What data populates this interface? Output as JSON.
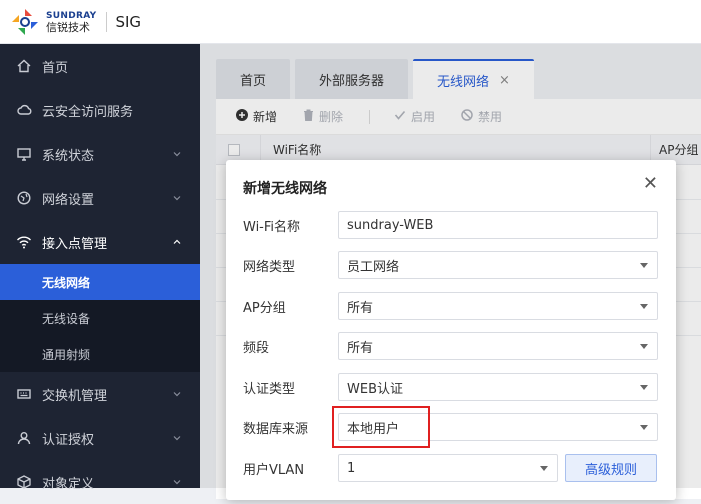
{
  "brand": {
    "en": "SUNDRAY",
    "cn": "信锐技术",
    "product": "SIG"
  },
  "sidebar": {
    "items": [
      {
        "label": "首页",
        "icon": "home-icon"
      },
      {
        "label": "云安全访问服务",
        "icon": "cloud-icon"
      },
      {
        "label": "系统状态",
        "icon": "monitor-icon"
      },
      {
        "label": "网络设置",
        "icon": "globe-icon"
      },
      {
        "label": "接入点管理",
        "icon": "wifi-icon"
      },
      {
        "label": "交换机管理",
        "icon": "switch-icon"
      },
      {
        "label": "认证授权",
        "icon": "user-icon"
      },
      {
        "label": "对象定义",
        "icon": "object-icon"
      }
    ],
    "submenu": [
      {
        "label": "无线网络",
        "active": true
      },
      {
        "label": "无线设备",
        "active": false
      },
      {
        "label": "通用射频",
        "active": false
      }
    ]
  },
  "tabs": [
    {
      "label": "首页",
      "active": false
    },
    {
      "label": "外部服务器",
      "active": false
    },
    {
      "label": "无线网络",
      "active": true
    }
  ],
  "toolbar": {
    "add": "新增",
    "delete": "删除",
    "enable": "启用",
    "disable": "禁用"
  },
  "table": {
    "columns": [
      "WiFi名称",
      "AP分组"
    ]
  },
  "modal": {
    "title": "新增无线网络",
    "fields": [
      {
        "label": "Wi-Fi名称",
        "value": "sundray-WEB",
        "type": "text"
      },
      {
        "label": "网络类型",
        "value": "员工网络",
        "type": "select"
      },
      {
        "label": "AP分组",
        "value": "所有",
        "type": "select"
      },
      {
        "label": "频段",
        "value": "所有",
        "type": "select"
      },
      {
        "label": "认证类型",
        "value": "WEB认证",
        "type": "select"
      },
      {
        "label": "数据库来源",
        "value": "本地用户",
        "type": "select"
      },
      {
        "label": "用户VLAN",
        "value": "1",
        "type": "select"
      }
    ],
    "advanced_button": "高级规则"
  },
  "colors": {
    "accent": "#2b5fd9",
    "sidebar_bg": "#1e2433",
    "highlight": "#e02020"
  }
}
